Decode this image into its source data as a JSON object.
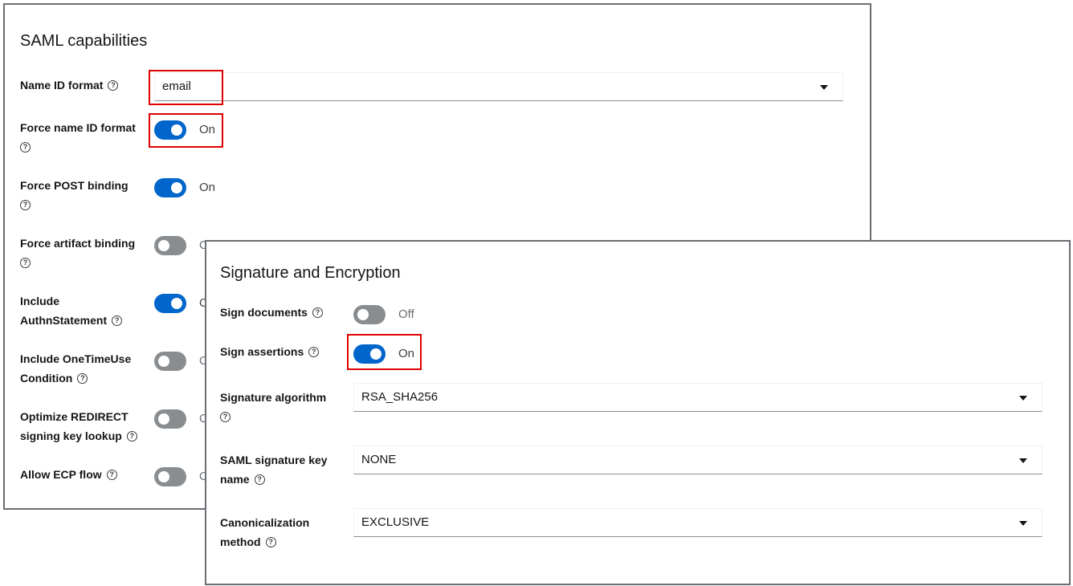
{
  "saml": {
    "title": "SAML capabilities",
    "name_id_format": {
      "label": "Name ID format",
      "value": "email"
    },
    "rows": [
      {
        "label_lines": [
          "Force name ID format"
        ],
        "state": "On",
        "on": true
      },
      {
        "label_lines": [
          "Force POST binding"
        ],
        "state": "On",
        "on": true
      },
      {
        "label_lines": [
          "Force artifact binding"
        ],
        "state": "Off",
        "on": false
      },
      {
        "label_lines": [
          "Include",
          "AuthnStatement"
        ],
        "state": "On",
        "on": true
      },
      {
        "label_lines": [
          "Include OneTimeUse",
          "Condition"
        ],
        "state": "Off",
        "on": false
      },
      {
        "label_lines": [
          "Optimize REDIRECT",
          "signing key lookup"
        ],
        "state": "Off",
        "on": false
      },
      {
        "label_lines": [
          "Allow ECP flow"
        ],
        "state": "Off",
        "on": false
      }
    ]
  },
  "signature": {
    "title": "Signature and Encryption",
    "sign_documents": {
      "label": "Sign documents",
      "state": "Off",
      "on": false
    },
    "sign_assertions": {
      "label": "Sign assertions",
      "state": "On",
      "on": true
    },
    "signature_algorithm": {
      "label": "Signature algorithm",
      "value": "RSA_SHA256"
    },
    "key_name": {
      "label_lines": [
        "SAML signature key",
        "name"
      ],
      "value": "NONE"
    },
    "canonicalization": {
      "label_lines": [
        "Canonicalization",
        "method"
      ],
      "value": "EXCLUSIVE"
    }
  },
  "icons": {
    "help": "help-circle-icon",
    "dropdown": "caret-down-icon"
  },
  "colors": {
    "toggle_on": "#0066cc",
    "toggle_off": "#8a8d90",
    "highlight": "#e00000"
  }
}
